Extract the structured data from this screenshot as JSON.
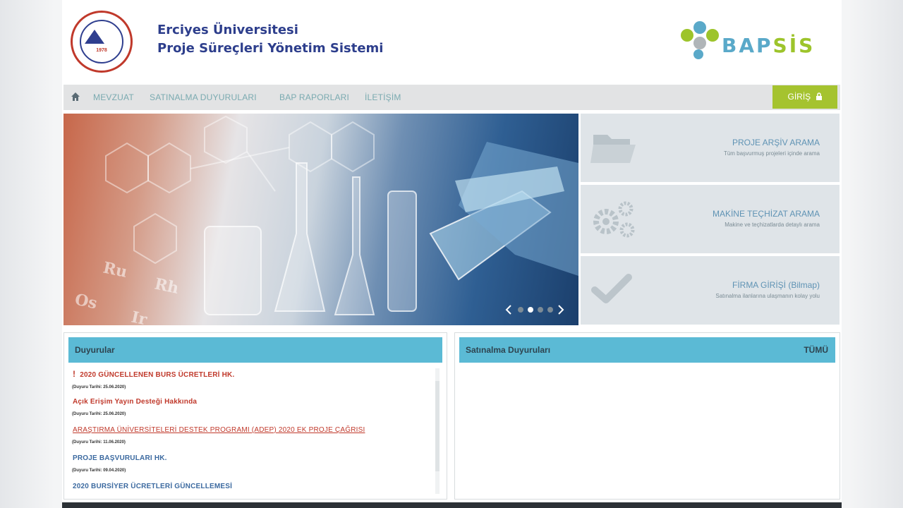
{
  "header": {
    "logo_year": "1978",
    "title_line1": "Erciyes Üniversitesi",
    "title_line2": "Proje Süreçleri Yönetim Sistemi",
    "brand_part1": "BAP",
    "brand_part2": "SİS"
  },
  "nav": {
    "items": [
      "MEVZUAT",
      "SATINALMA DUYURULARI",
      "BAP RAPORLARI",
      "İLETİŞİM"
    ],
    "login_label": "GİRİŞ"
  },
  "cards": [
    {
      "title": "PROJE ARŞİV ARAMA",
      "desc": "Tüm başvurmuş projeleri içinde arama",
      "icon": "folder-icon"
    },
    {
      "title": "MAKİNE TEÇHİZAT ARAMA",
      "desc": "Makine ve teçhizatlarda detaylı arama",
      "icon": "gears-icon"
    },
    {
      "title": "FİRMA GİRİŞİ (Bilmap)",
      "desc": "Satınalma ilanlarına ulaşmanın kolay yolu",
      "icon": "check-icon"
    }
  ],
  "announcements": {
    "heading": "Duyurular",
    "items": [
      {
        "title": "2020 GÜNCELLENEN BURS ÜCRETLERİ HK.",
        "date": "(Duyuru Tarihi: 25.06.2020)",
        "alert": true,
        "color": "#c0392b"
      },
      {
        "title": "Açık Erişim Yayın Desteği Hakkında",
        "date": "(Duyuru Tarihi: 25.06.2020)",
        "alert": false,
        "color": "#c0392b"
      },
      {
        "title": "ARAŞTIRMA ÜNİVERSİTELERİ DESTEK PROGRAMI (ADEP) 2020 EK PROJE ÇAĞRISI",
        "date": "(Duyuru Tarihi: 11.06.2020)",
        "alert": false,
        "color": "#c0392b"
      },
      {
        "title": "PROJE BAŞVURULARI HK.",
        "date": "(Duyuru Tarihi: 09.04.2020)",
        "alert": false,
        "color": "#3c6aa0"
      },
      {
        "title": "2020 BURSİYER ÜCRETLERİ GÜNCELLEMESİ",
        "date": "",
        "alert": false,
        "color": "#3c6aa0"
      }
    ]
  },
  "procurement": {
    "heading": "Satınalma Duyuruları",
    "all_label": "TÜMÜ"
  },
  "colors": {
    "nav_link": "#7aaab0",
    "accent_green": "#a5c32f",
    "panel_header": "#5bbad5",
    "title_blue": "#2d3e8c"
  },
  "slider": {
    "dots": 4,
    "active_index": 1
  }
}
